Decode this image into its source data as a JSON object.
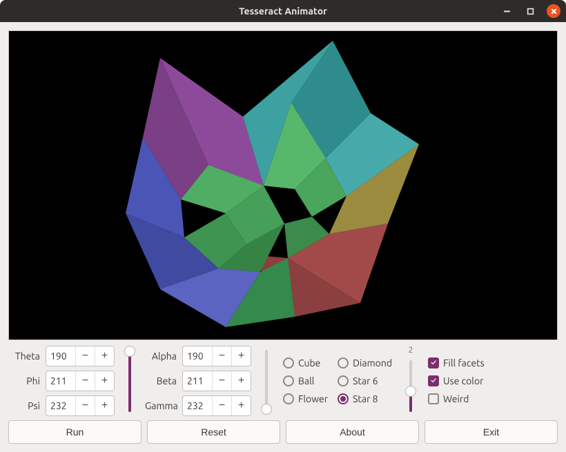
{
  "window": {
    "title": "Tesseract Animator"
  },
  "angles1": [
    {
      "label": "Theta",
      "value": "190"
    },
    {
      "label": "Phi",
      "value": "211"
    },
    {
      "label": "Psi",
      "value": "232"
    }
  ],
  "angles2": [
    {
      "label": "Alpha",
      "value": "190"
    },
    {
      "label": "Beta",
      "value": "211"
    },
    {
      "label": "Gamma",
      "value": "232"
    }
  ],
  "slider1_pct": 98,
  "slider2_pct": 5,
  "shapes_col1": [
    {
      "label": "Cube",
      "selected": false
    },
    {
      "label": "Ball",
      "selected": false
    },
    {
      "label": "Flower",
      "selected": false
    }
  ],
  "shapes_col2": [
    {
      "label": "Diamond",
      "selected": false
    },
    {
      "label": "Star 6",
      "selected": false
    },
    {
      "label": "Star 8",
      "selected": true
    }
  ],
  "num_slider": {
    "top_label": "2",
    "pct": 40
  },
  "checks": [
    {
      "label": "Fill facets",
      "checked": true
    },
    {
      "label": "Use color",
      "checked": true
    },
    {
      "label": "Weird",
      "checked": false
    }
  ],
  "buttons": {
    "run": "Run",
    "reset": "Reset",
    "about": "About",
    "exit": "Exit"
  },
  "colors": {
    "accent": "#7b2e6e",
    "titlebar": "#2e2b29",
    "close_btn": "#e95420"
  }
}
